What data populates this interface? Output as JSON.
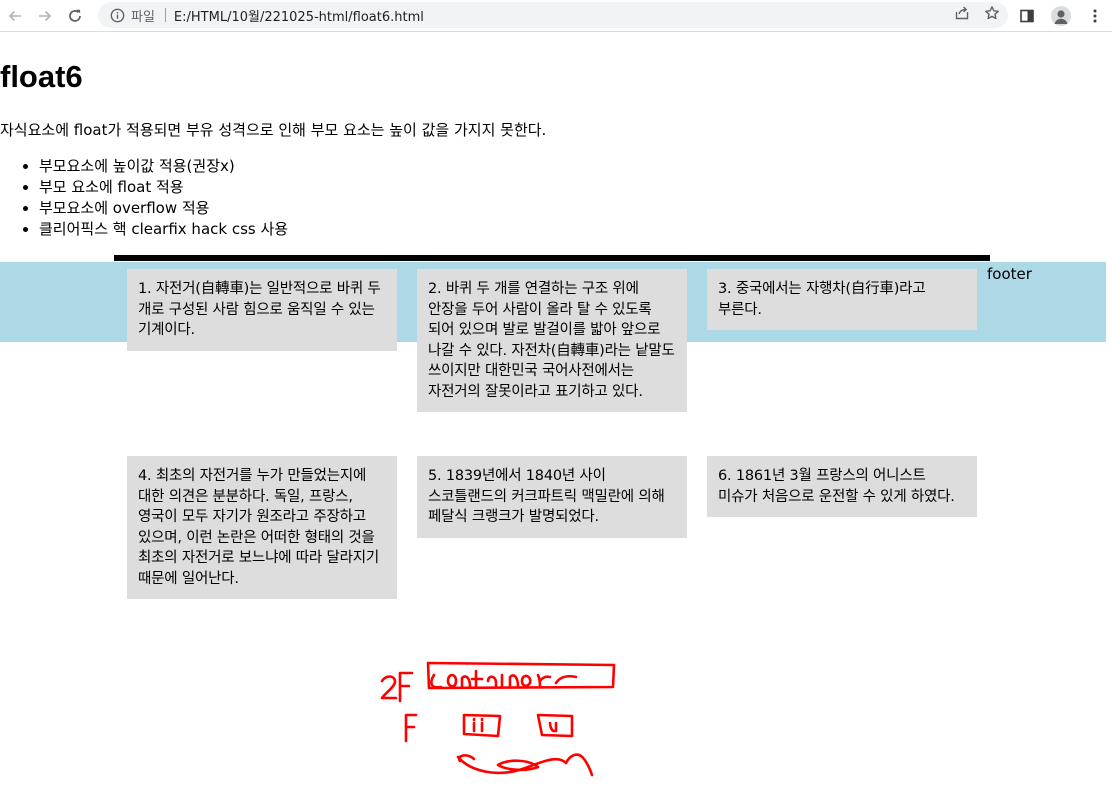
{
  "browser": {
    "protocol_label": "파일",
    "url": "E:/HTML/10월/221025-html/float6.html"
  },
  "page": {
    "title": "float6",
    "intro": "자식요소에 float가 적용되면 부유 성격으로 인해 부모 요소는 높이 값을 가지지 못한다.",
    "methods": [
      "부모요소에 높이값 적용(권장x)",
      "부모 요소에 float 적용",
      "부모요소에 overflow 적용",
      "클리어픽스 핵 clearfix hack css 사용"
    ],
    "footer_label": "footer",
    "cards": [
      "1. 자전거(自轉車)는 일반적으로 바퀴 두 개로 구성된 사람 힘으로 움직일 수 있는 기계이다.",
      "2. 바퀴 두 개를 연결하는 구조 위에 안장을 두어 사람이 올라 탈 수 있도록 되어 있으며 발로 발걸이를 밟아 앞으로 나갈 수 있다. 자전차(自轉車)라는 낱말도 쓰이지만 대한민국 국어사전에서는 자전거의 잘못이라고 표기하고 있다.",
      "3. 중국에서는 자행차(自行車)라고 부른다.",
      "4. 최초의 자전거를 누가 만들었는지에 대한 의견은 분분하다. 독일, 프랑스, 영국이 모두 자기가 원조라고 주장하고 있으며, 이런 논란은 어떠한 형태의 것을 최초의 자전거로 보느냐에 따라 달라지기 때문에 일어난다.",
      "5. 1839년에서 1840년 사이 스코틀랜드의 커크파트릭 맥밀란에 의해 페달식 크랭크가 발명되었다.",
      "6. 1861년 3월 프랑스의 어니스트 미슈가 처음으로 운전할 수 있게 하였다."
    ],
    "colors": {
      "footer_band": "#add8e6",
      "card": "#dddddd",
      "rule": "#000000",
      "annotation": "#ff0000"
    }
  }
}
